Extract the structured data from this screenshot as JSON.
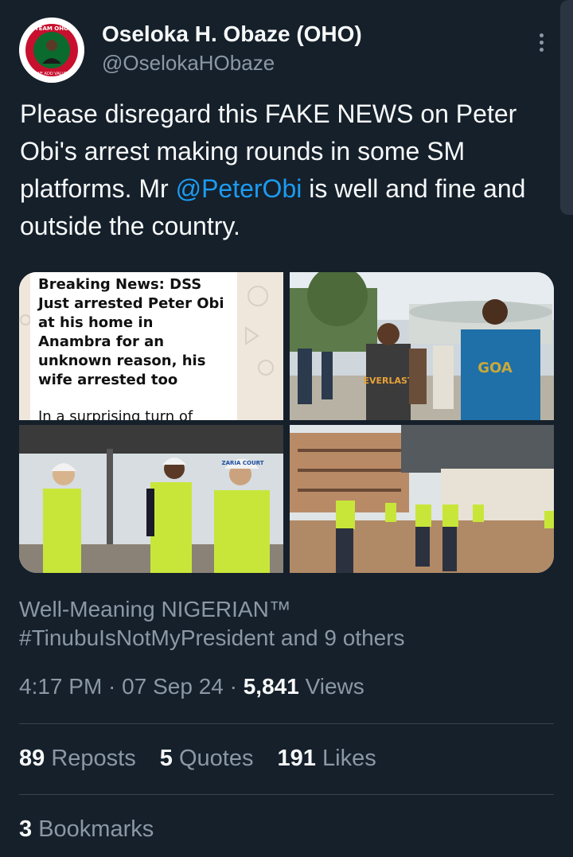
{
  "author": {
    "name": "Oseloka H. Obaze (OHO)",
    "handle": "@OselokaHObaze",
    "avatar_icon": "avatar-logo-icon",
    "avatar_text_top": "TEAM OHO",
    "avatar_text_bottom": "WE ADD VALUE"
  },
  "tweet": {
    "text_before": "Please disregard this FAKE NEWS on Peter Obi's arrest making rounds in some SM platforms.  Mr ",
    "mention": "@PeterObi",
    "text_after": " is well and fine and outside the country."
  },
  "media": {
    "screenshot_card": {
      "headline": "Breaking News: DSS Just arrested Peter Obi at his home in Anambra for an unknown reason, his wife arrested too",
      "body": "In a surprising turn of events, former"
    },
    "photo_tshirt_text": "EVERLAST",
    "photo_goa_text": "GOA",
    "photo_helmet_text": "ZARIA COURT"
  },
  "liked_by": {
    "line1": "Well-Meaning NIGERIAN™",
    "line2": "#TinubuIsNotMyPresident and 9 others"
  },
  "meta": {
    "time": "4:17 PM",
    "sep1": " · ",
    "date": "07 Sep 24",
    "sep2": " · ",
    "views_count": "5,841",
    "views_label": " Views"
  },
  "stats": {
    "reposts_count": "89",
    "reposts_label": " Reposts",
    "quotes_count": "5",
    "quotes_label": " Quotes",
    "likes_count": "191",
    "likes_label": " Likes",
    "bookmarks_count": "3",
    "bookmarks_label": " Bookmarks"
  },
  "colors": {
    "background": "#15202b",
    "text": "#f7f9f9",
    "secondary": "#8b98a5",
    "accent": "#1d9bf0",
    "divider": "#38444d"
  }
}
